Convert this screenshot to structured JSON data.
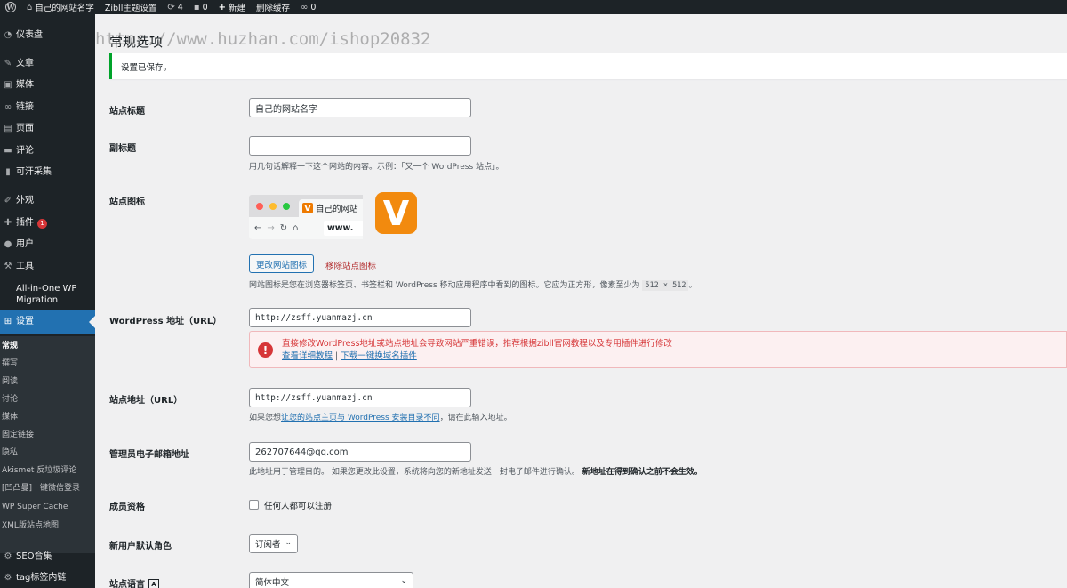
{
  "adminbar": {
    "site_name": "自己的网站名字",
    "theme_settings": "Zibll主题设置",
    "updates_count": "4",
    "comments_count": "0",
    "new_label": "新建",
    "clear_cache": "删除缓存",
    "links_count": "0"
  },
  "sidebar": {
    "items": [
      {
        "label": "仪表盘",
        "icon": "dashboard-icon"
      },
      {
        "label": "文章",
        "icon": "pin-icon"
      },
      {
        "label": "媒体",
        "icon": "media-icon"
      },
      {
        "label": "链接",
        "icon": "link-icon"
      },
      {
        "label": "页面",
        "icon": "page-icon"
      },
      {
        "label": "评论",
        "icon": "comment-icon"
      },
      {
        "label": "可汗采集",
        "icon": "collect-icon"
      },
      {
        "label": "外观",
        "icon": "brush-icon"
      },
      {
        "label": "插件",
        "icon": "plugin-icon",
        "badge": "1"
      },
      {
        "label": "用户",
        "icon": "user-icon"
      },
      {
        "label": "工具",
        "icon": "wrench-icon"
      },
      {
        "label": "All-in-One WP",
        "label2": "Migration",
        "icon": "migration-icon"
      },
      {
        "label": "设置",
        "icon": "settings-icon",
        "current": true
      },
      {
        "label": "SEO合集",
        "icon": "gear-icon"
      },
      {
        "label": "tag标签内链",
        "icon": "gear-icon"
      }
    ],
    "submenu": [
      "常规",
      "撰写",
      "阅读",
      "讨论",
      "媒体",
      "固定链接",
      "隐私",
      "Akismet 反垃圾评论",
      "[凹凸曼]一键微信登录",
      "WP Super Cache",
      "XML版站点地图"
    ]
  },
  "page": {
    "title": "常规选项",
    "watermark": "https://www.huzhan.com/ishop20832",
    "notice": "设置已保存。"
  },
  "form": {
    "site_title_label": "站点标题",
    "site_title_value": "自己的网站名字",
    "tagline_label": "副标题",
    "tagline_value": "",
    "tagline_desc": "用几句话解释一下这个网站的内容。示例：「又一个 WordPress 站点」。",
    "site_icon_label": "站点图标",
    "preview_tab_text": "自己的网站",
    "preview_address": "www.",
    "change_icon_button": "更改网站图标",
    "remove_icon_link": "移除站点图标",
    "site_icon_desc": "网站图标是您在浏览器标签页、书签栏和 WordPress 移动应用程序中看到的图标。它应为正方形，像素至少为",
    "site_icon_size": "512 × 512",
    "site_icon_desc_end": "。",
    "wp_address_label": "WordPress 地址（URL）",
    "wp_address_value": "http://zsff.yuanmazj.cn",
    "warning_text": "直接修改WordPress地址或站点地址会导致网站严重错误，推荐根据zibll官网教程以及专用插件进行修改",
    "warning_link1": "查看详细教程",
    "warning_sep": " | ",
    "warning_link2": "下载一键换域名插件",
    "site_address_label": "站点地址（URL）",
    "site_address_value": "http://zsff.yuanmazj.cn",
    "site_address_desc_pre": "如果您想",
    "site_address_desc_link": "让您的站点主页与 WordPress 安装目录不同",
    "site_address_desc_post": "，请在此输入地址。",
    "admin_email_label": "管理员电子邮箱地址",
    "admin_email_value": "262707644@qq.com",
    "admin_email_desc": "此地址用于管理目的。 如果您更改此设置，系统将向您的新地址发送一封电子邮件进行确认。",
    "admin_email_desc_bold": "新地址在得到确认之前不会生效。",
    "membership_label": "成员资格",
    "membership_checkbox": "任何人都可以注册",
    "default_role_label": "新用户默认角色",
    "default_role_value": "订阅者",
    "site_language_label": "站点语言",
    "site_language_value": "简体中文"
  }
}
